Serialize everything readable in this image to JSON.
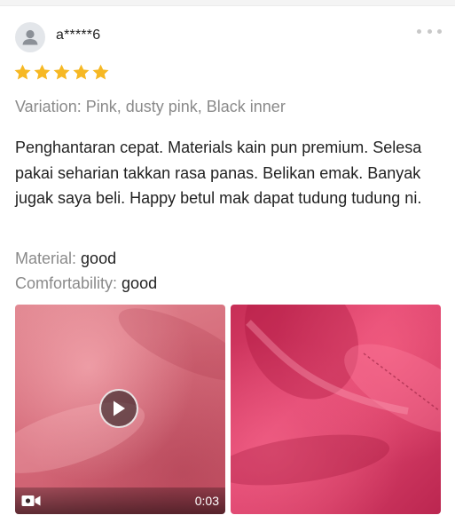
{
  "review": {
    "username": "a*****6",
    "rating": 5,
    "rating_max": 5,
    "variation": "Variation: Pink, dusty pink, Black inner",
    "body": "Penghantaran cepat. Materials kain pun premium. Selesa pakai seharian takkan rasa panas. Belikan emak. Banyak jugak saya beli. Happy betul mak dapat tudung tudung ni.",
    "attributes": [
      {
        "label": "Material:",
        "value": "good"
      },
      {
        "label": "Comfortability:",
        "value": "good"
      }
    ],
    "media": {
      "video_duration": "0:03"
    }
  },
  "icons": {
    "avatar": "user-silhouette-icon",
    "more": "more-dots-icon",
    "star": "star-icon",
    "play": "play-icon",
    "video": "video-camera-icon"
  },
  "colors": {
    "star": "#f6b824",
    "muted_text": "#8a8a8a",
    "body_text": "#222222"
  }
}
